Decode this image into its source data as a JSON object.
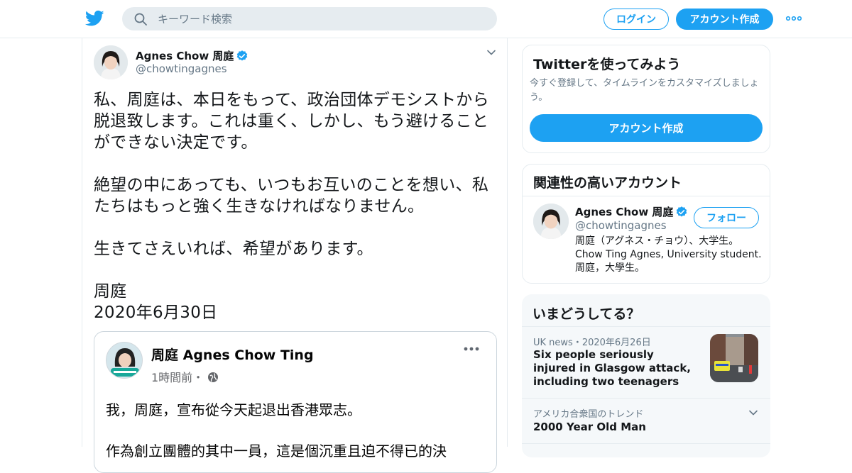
{
  "header": {
    "search_placeholder": "キーワード検索",
    "login_label": "ログイン",
    "signup_label": "アカウント作成",
    "brand_color": "#1da1f2"
  },
  "tweet": {
    "author_name": "Agnes Chow 周庭",
    "author_handle": "@chowtingagnes",
    "text": "私、周庭は、本日をもって、政治団体デモシストから\n脱退致します。これは重く、しかし、もう避けること\nができない決定です。\n\n絶望の中にあっても、いつもお互いのことを想い、私\nたちはもっと強く生きなければなりません。\n\n生きてさえいれば、希望があります。\n\n周庭\n2020年6月30日",
    "embed": {
      "name": "周庭 Agnes Chow Ting",
      "meta": "1時間前・",
      "line1": "我，周庭，宣布從今天起退出香港眾志。",
      "line2": "作為創立團體的其中一員，這是個沉重且迫不得已的決"
    }
  },
  "sidebar": {
    "signup_card": {
      "title": "Twitterを使ってみよう",
      "description": "今すぐ登録して、タイムラインをカスタマイズしましょう。",
      "button": "アカウント作成"
    },
    "related_card": {
      "title": "関連性の高いアカウント",
      "name": "Agnes Chow 周庭",
      "handle": "@chowtingagnes",
      "follow_label": "フォロー",
      "bio": "周庭（アグネス・チョウ）、大学生。\nChow Ting Agnes, University student.\n周庭，大學生。"
    },
    "trends_card": {
      "title": "いまどうしてる？",
      "item1_meta": "UK news・2020年6月26日",
      "item1_headline": "Six people seriously injured in Glasgow attack, including two teenagers",
      "item2_meta": "アメリカ合衆国のトレンド",
      "item2_headline": "2000 Year Old Man"
    }
  }
}
